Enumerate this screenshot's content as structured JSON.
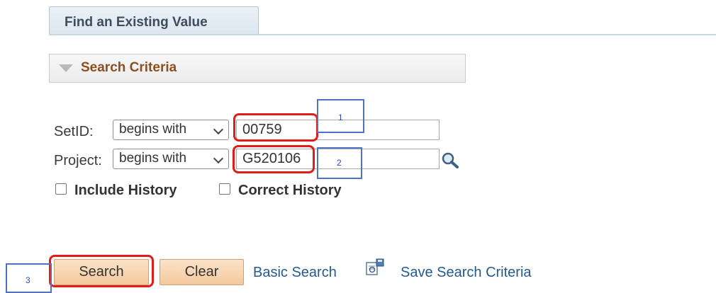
{
  "tab": {
    "label": "Find an Existing Value"
  },
  "section": {
    "title": "Search Criteria"
  },
  "fields": [
    {
      "label": "SetID:",
      "operator": "begins with",
      "value": "00759"
    },
    {
      "label": "Project:",
      "operator": "begins with",
      "value": "G520106"
    }
  ],
  "checkboxes": [
    {
      "label": "Include History",
      "checked": false
    },
    {
      "label": "Correct History",
      "checked": false
    }
  ],
  "buttons": {
    "search": "Search",
    "clear": "Clear"
  },
  "links": {
    "basic_search": "Basic Search",
    "save_search": "Save Search Criteria"
  },
  "annotations": {
    "a1": "1",
    "a2": "2",
    "a3": "3"
  },
  "colors": {
    "highlight": "#e21b1b",
    "annotation": "#4f73c4",
    "section_title": "#8c4f1f",
    "link": "#245a8f"
  }
}
